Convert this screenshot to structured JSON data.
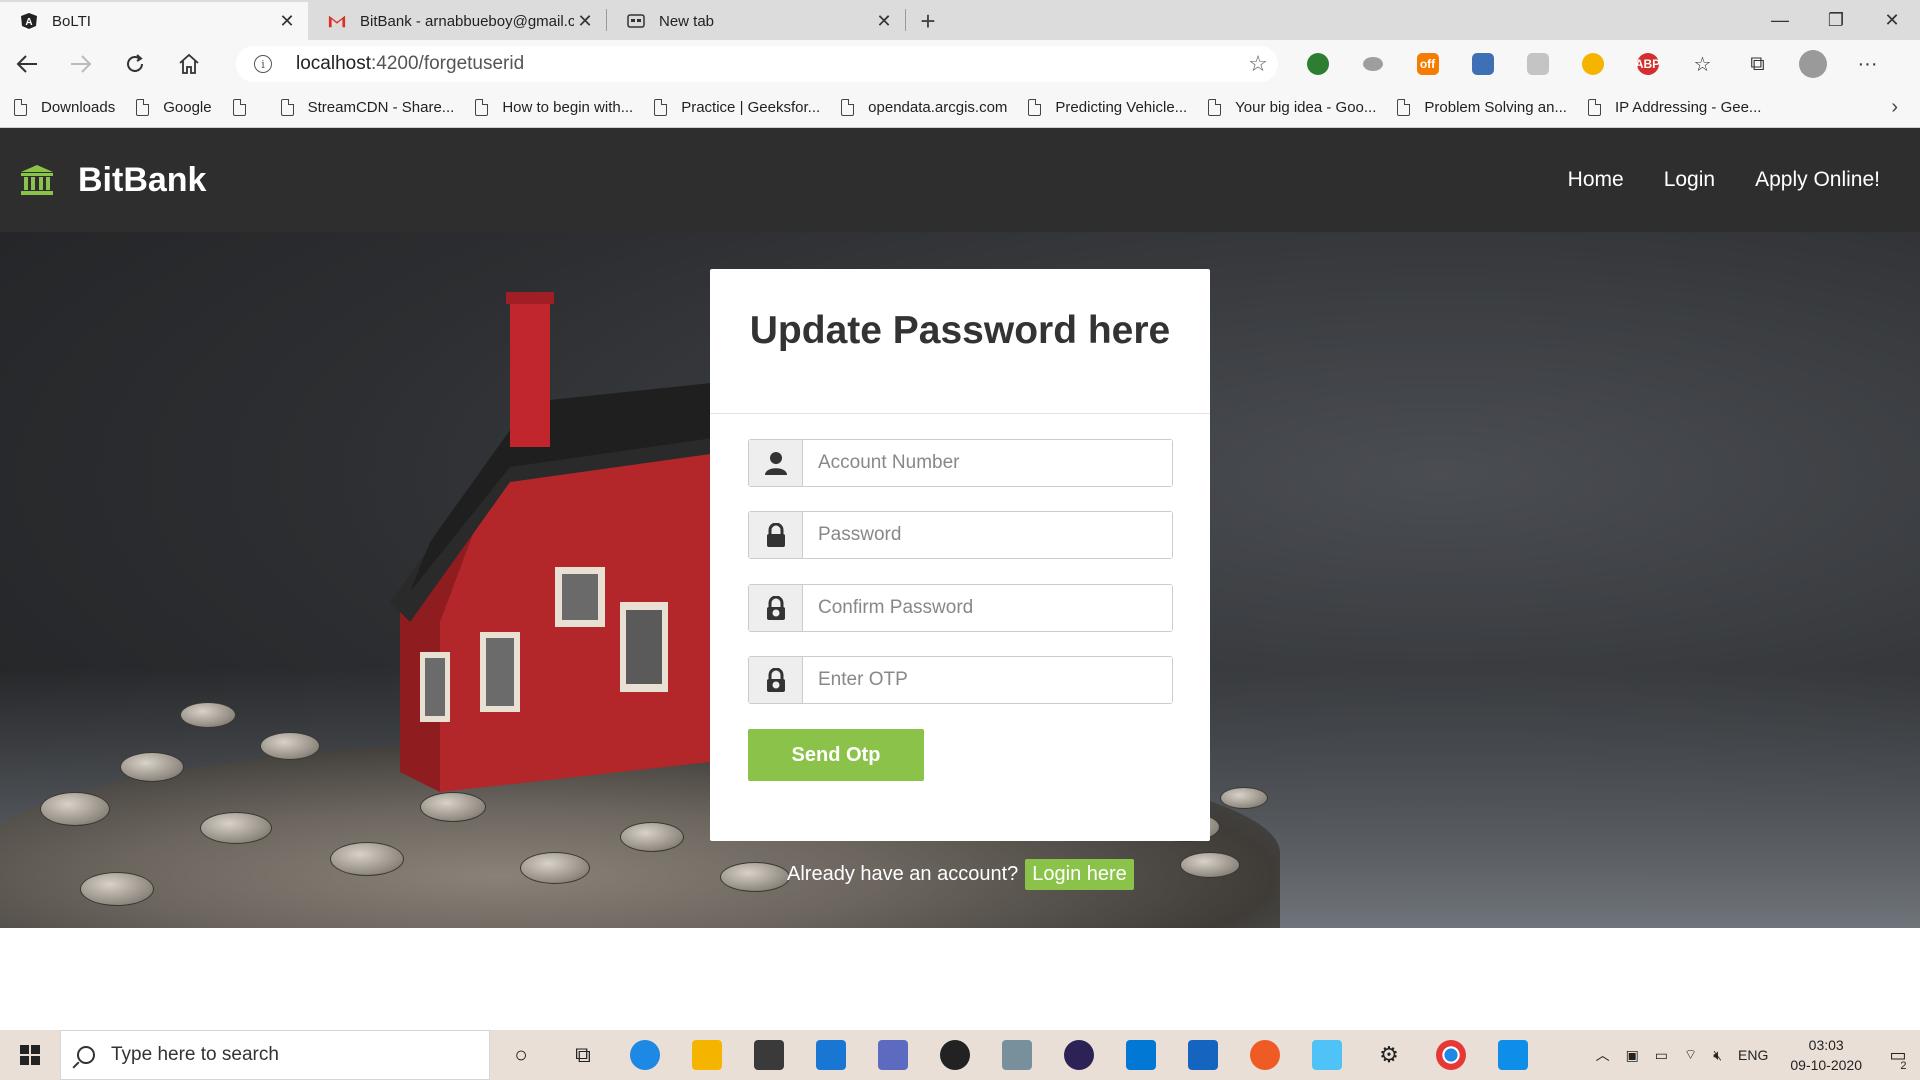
{
  "browser": {
    "tabs": [
      {
        "title": "BoLTI",
        "icon": "angular-icon",
        "active": true
      },
      {
        "title": "BitBank - arnabbueboy@gmail.c",
        "icon": "gmail-icon",
        "active": false
      },
      {
        "title": "New tab",
        "icon": "newtab-icon",
        "active": false
      }
    ],
    "address": {
      "host": "localhost",
      "path": ":4200/forgetuserid"
    },
    "bookmarks": [
      "Downloads",
      "Google",
      "",
      "StreamCDN - Share...",
      "How to begin with...",
      "Practice | Geeksfor...",
      "opendata.arcgis.com",
      "Predicting Vehicle...",
      "Your big idea - Goo...",
      "Problem Solving an...",
      "IP Addressing - Gee..."
    ]
  },
  "app": {
    "brand": "BitBank",
    "nav": {
      "home": "Home",
      "login": "Login",
      "apply": "Apply Online!"
    },
    "form": {
      "title": "Update Password here",
      "account_placeholder": "Account Number",
      "password_placeholder": "Password",
      "confirm_placeholder": "Confirm Password",
      "otp_placeholder": "Enter OTP",
      "send_label": "Send Otp"
    },
    "footer_text": "Already have an account?",
    "login_link": "Login here",
    "accent_color": "#8bc34a"
  },
  "taskbar": {
    "search_placeholder": "Type here to search",
    "language": "ENG",
    "time": "03:03",
    "date": "09-10-2020",
    "notification_count": "2"
  }
}
